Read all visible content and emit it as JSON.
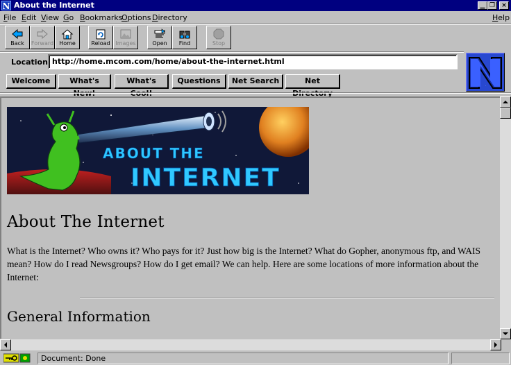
{
  "window": {
    "title": "About the Internet"
  },
  "menu": [
    "File",
    "Edit",
    "View",
    "Go",
    "Bookmarks",
    "Options",
    "Directory",
    "Help"
  ],
  "toolbar": {
    "back": "Back",
    "forward": "Forward",
    "home": "Home",
    "reload": "Reload",
    "images": "Images",
    "open": "Open",
    "find": "Find",
    "stop": "Stop"
  },
  "location": {
    "label": "Location:",
    "url": "http://home.mcom.com/home/about-the-internet.html"
  },
  "directory_buttons": [
    "Welcome",
    "What's New!",
    "What's Cool!",
    "Questions",
    "Net Search",
    "Net Directory"
  ],
  "logo": {
    "letter": "N"
  },
  "content": {
    "banner_text_1": "ABOUT THE",
    "banner_text_2": "INTERNET",
    "heading": "About The Internet",
    "intro": "What is the Internet? Who owns it? Who pays for it? Just how big is the Internet? What do Gopher, anonymous ftp, and WAIS mean? How do I read Newsgroups? How do I get email? We can help. Here are some locations of more information about the Internet:",
    "subheading": "General Information"
  },
  "status": {
    "text": "Document: Done"
  },
  "colors": {
    "titlebar": "#000080",
    "chrome": "#c0c0c0",
    "logo": "#2040c0"
  }
}
